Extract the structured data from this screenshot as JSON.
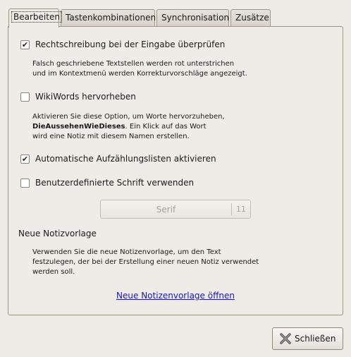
{
  "tabs": [
    {
      "label": "Bearbeiten",
      "active": true
    },
    {
      "label": "Tastenkombinationen",
      "active": false
    },
    {
      "label": "Synchronisation",
      "active": false
    },
    {
      "label": "Zusätze",
      "active": false
    }
  ],
  "options": {
    "spellcheck": {
      "label": "Rechtschreibung bei der Eingabe überprüfen",
      "checked": true
    },
    "spellcheck_desc_1": "Falsch geschriebene Textstellen werden rot unterstrichen",
    "spellcheck_desc_2": "und im Kontextmenü werden Korrekturvorschläge angezeigt.",
    "wikiwords": {
      "label": "WikiWords hervorheben",
      "checked": false
    },
    "wikiwords_desc_1": "Aktivieren Sie diese Option, um Worte hervorzuheben,",
    "wikiwords_desc_2_bold": "DieAussehenWieDieses",
    "wikiwords_desc_2_rest": ". Ein Klick auf das Wort",
    "wikiwords_desc_3": "wird eine Notiz mit diesem Namen erstellen.",
    "autobullet": {
      "label": "Automatische Aufzählungslisten aktivieren",
      "checked": true
    },
    "customfont": {
      "label": "Benutzerdefinierte Schrift verwenden",
      "checked": false
    }
  },
  "font_button": {
    "name": "Serif",
    "size": "11"
  },
  "template": {
    "title": "Neue Notizvorlage",
    "desc_1": "Verwenden Sie die neue Notizenvorlage, um den Text",
    "desc_2": "festzulegen, der bei der Erstellung einer neuen Notiz verwendet",
    "desc_3": "werden soll.",
    "link": "Neue Notizenvorlage öffnen"
  },
  "close_button": {
    "label": "Schließen",
    "icon": "close-icon"
  },
  "colors": {
    "link": "#1a1aa6",
    "background": "#efebe7"
  }
}
